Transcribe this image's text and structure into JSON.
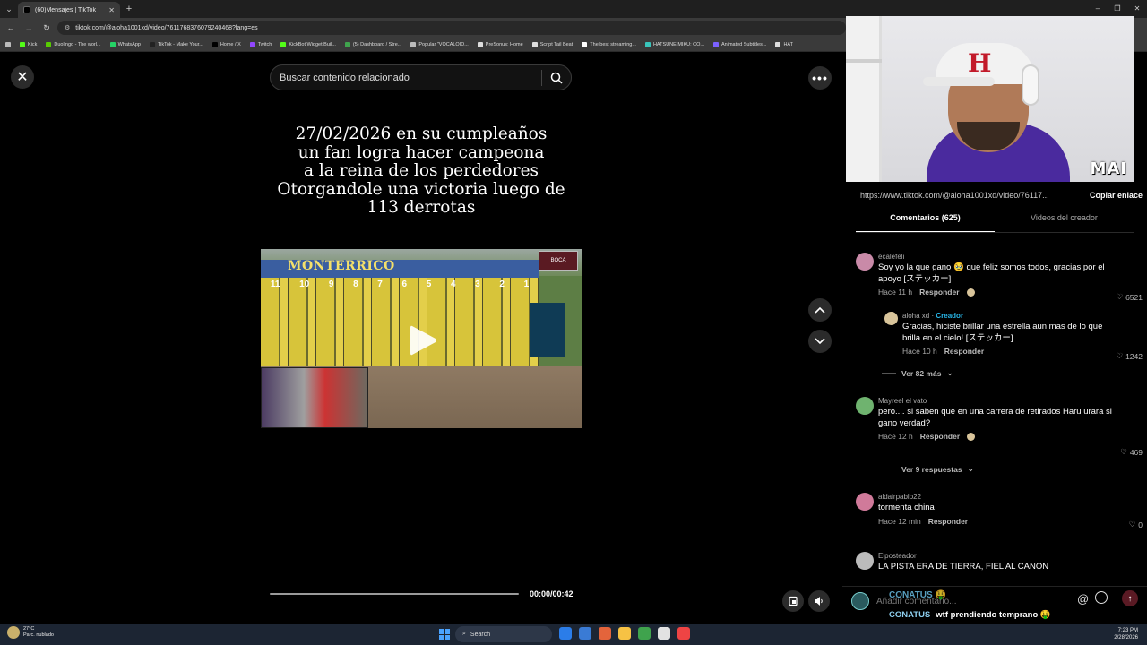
{
  "browser": {
    "tab_title": "(60)Mensajes | TikTok",
    "tab_close": "✕",
    "new_tab": "+",
    "window_controls": [
      "–",
      "❐",
      "✕"
    ],
    "url": "tiktok.com/@aloha1001xd/video/7611768376079240468?lang=es",
    "bookmarks": [
      {
        "label": "Kick",
        "color": "#53fc18"
      },
      {
        "label": "Duolingo - The worl...",
        "color": "#58cc02"
      },
      {
        "label": "WhatsApp",
        "color": "#25d366"
      },
      {
        "label": "TikTok - Make Your...",
        "color": "#222222"
      },
      {
        "label": "Home / X",
        "color": "#000000"
      },
      {
        "label": "Twitch",
        "color": "#9146ff"
      },
      {
        "label": "KickBot Widget Buil...",
        "color": "#53fc18"
      },
      {
        "label": "(5) Dashboard / Stre...",
        "color": "#3fa34d"
      },
      {
        "label": "Popular \"VOCALOID...",
        "color": "#bbbbbb"
      },
      {
        "label": "PreSonus: Home",
        "color": "#dddddd"
      },
      {
        "label": "Script Tail Beat",
        "color": "#dddddd"
      },
      {
        "label": "The best streaming...",
        "color": "#ffffff"
      },
      {
        "label": "HATSUNE MIKU: CO...",
        "color": "#39c5bb"
      },
      {
        "label": "Animated Subtitles...",
        "color": "#7b61ff"
      },
      {
        "label": "HAT",
        "color": "#dddddd"
      }
    ]
  },
  "viewer": {
    "search_placeholder": "Buscar contenido relacionado",
    "caption_lines": [
      "27/02/2026 en su cumpleaños",
      "un fan logra hacer campeona",
      "a la reina de los perdedores",
      "Otorgandole una victoria luego de",
      "113 derrotas"
    ],
    "clip_brand": "MONTERRICO",
    "clip_logo": "BOCA",
    "gate_numbers": [
      "11",
      "10",
      "9",
      "8",
      "7",
      "6",
      "5",
      "4",
      "3",
      "2",
      "1"
    ],
    "time": "00:00/00:42",
    "progress": 0
  },
  "stream_overlay": {
    "tag": "MAI"
  },
  "panel": {
    "share_url": "https://www.tiktok.com/@aloha1001xd/video/76117...",
    "copy_label": "Copiar enlace",
    "tab_comments": "Comentarios (625)",
    "tab_creator": "Videos del creador",
    "comments": [
      {
        "user": "ecalefeli",
        "text": "Soy yo la que gano 🥹 que feliz somos todos, gracias por el apoyo [ステッカー]",
        "time": "Hace 11 h",
        "reply": "Responder",
        "likes": "6521",
        "avatar_color": "#c98aa8"
      },
      {
        "user": "aloha xd",
        "creator": "Creador",
        "text": "Gracias, hiciste brillar una estrella aun mas de lo que brilla en el cielo! [ステッカー]",
        "time": "Hace 10 h",
        "reply": "Responder",
        "likes": "1242",
        "avatar_color": "#d8c49a"
      },
      {
        "user": "Mayreel el vato",
        "text": "pero.... si saben que en una carrera de retirados Haru urara si gano verdad?",
        "time": "Hace 12 h",
        "reply": "Responder",
        "likes": "469",
        "avatar_color": "#6fb36f"
      },
      {
        "user": "aldairpablo22",
        "text": "tormenta china",
        "time": "Hace 12 min",
        "reply": "Responder",
        "likes": "0",
        "avatar_color": "#d07a9a"
      },
      {
        "user": "Elposteador",
        "text": "LA PISTA ERA DE TIERRA, FIEL AL CANON",
        "avatar_color": "#bbbbbb"
      }
    ],
    "more_replies_1": "Ver 82 más",
    "more_replies_2": "Ver 9 respuestas",
    "composer_placeholder": "Añadir comentario...",
    "composer_at": "@",
    "chat_user": "CONATUS",
    "chat_text": "wtf prendiendo temprano 🤑",
    "chat_ghost": "CONATUS 🤑"
  },
  "taskbar": {
    "temp": "27°C",
    "weather": "Parc. nublado",
    "search": "Search",
    "time": "7:23 PM",
    "date": "2/28/2026",
    "app_colors": [
      "#2b7de9",
      "#3a7bd5",
      "#e4643b",
      "#f6c244",
      "#3fa34d",
      "#e2e2e2",
      "#e44"
    ]
  }
}
